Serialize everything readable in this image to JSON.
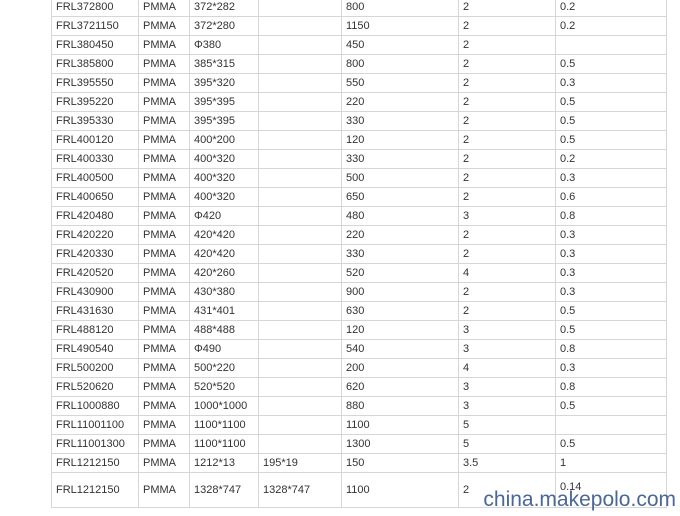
{
  "table": {
    "rows": [
      [
        "FRL372800",
        "PMMA",
        "372*282",
        "",
        "800",
        "2",
        "0.2"
      ],
      [
        "FRL3721150",
        "PMMA",
        "372*280",
        "",
        "1150",
        "2",
        "0.2"
      ],
      [
        "FRL380450",
        "PMMA",
        "Φ380",
        "",
        "450",
        "2",
        ""
      ],
      [
        "FRL385800",
        "PMMA",
        "385*315",
        "",
        "800",
        "2",
        "0.5"
      ],
      [
        "FRL395550",
        "PMMA",
        "395*320",
        "",
        "550",
        "2",
        "0.3"
      ],
      [
        "FRL395220",
        "PMMA",
        "395*395",
        "",
        "220",
        "2",
        "0.5"
      ],
      [
        "FRL395330",
        "PMMA",
        "395*395",
        "",
        "330",
        "2",
        "0.5"
      ],
      [
        "FRL400120",
        "PMMA",
        "400*200",
        "",
        "120",
        "2",
        "0.5"
      ],
      [
        "FRL400330",
        "PMMA",
        "400*320",
        "",
        "330",
        "2",
        "0.2"
      ],
      [
        "FRL400500",
        "PMMA",
        "400*320",
        "",
        "500",
        "2",
        "0.3"
      ],
      [
        "FRL400650",
        "PMMA",
        "400*320",
        "",
        "650",
        "2",
        "0.6"
      ],
      [
        "FRL420480",
        "PMMA",
        "Φ420",
        "",
        "480",
        "3",
        "0.8"
      ],
      [
        "FRL420220",
        "PMMA",
        "420*420",
        "",
        "220",
        "2",
        "0.3"
      ],
      [
        "FRL420330",
        "PMMA",
        "420*420",
        "",
        "330",
        "2",
        "0.3"
      ],
      [
        "FRL420520",
        "PMMA",
        "420*260",
        "",
        "520",
        "4",
        "0.3"
      ],
      [
        "FRL430900",
        "PMMA",
        "430*380",
        "",
        "900",
        "2",
        "0.3"
      ],
      [
        "FRL431630",
        "PMMA",
        "431*401",
        "",
        "630",
        "2",
        "0.5"
      ],
      [
        "FRL488120",
        "PMMA",
        "488*488",
        "",
        "120",
        "3",
        "0.5"
      ],
      [
        "FRL490540",
        "PMMA",
        "Φ490",
        "",
        "540",
        "3",
        "0.8"
      ],
      [
        "FRL500200",
        "PMMA",
        "500*220",
        "",
        "200",
        "4",
        "0.3"
      ],
      [
        "FRL520620",
        "PMMA",
        "520*520",
        "",
        "620",
        "3",
        "0.8"
      ],
      [
        "FRL1000880",
        "PMMA",
        "1000*1000",
        "",
        "880",
        "3",
        "0.5"
      ],
      [
        "FRL11001100",
        "PMMA",
        "1100*1100",
        "",
        "1100",
        "5",
        ""
      ],
      [
        "FRL11001300",
        "PMMA",
        "1100*1100",
        "",
        "1300",
        "5",
        "0.5"
      ],
      [
        "FRL1212150",
        "PMMA",
        "1212*13",
        "195*19",
        "150",
        "3.5",
        "1"
      ],
      [
        "FRL1212150",
        "PMMA",
        "1328*747",
        "1328*747",
        "1100",
        "2",
        "0.14"
      ]
    ]
  },
  "watermark": {
    "text": "china.makepolo.com"
  }
}
